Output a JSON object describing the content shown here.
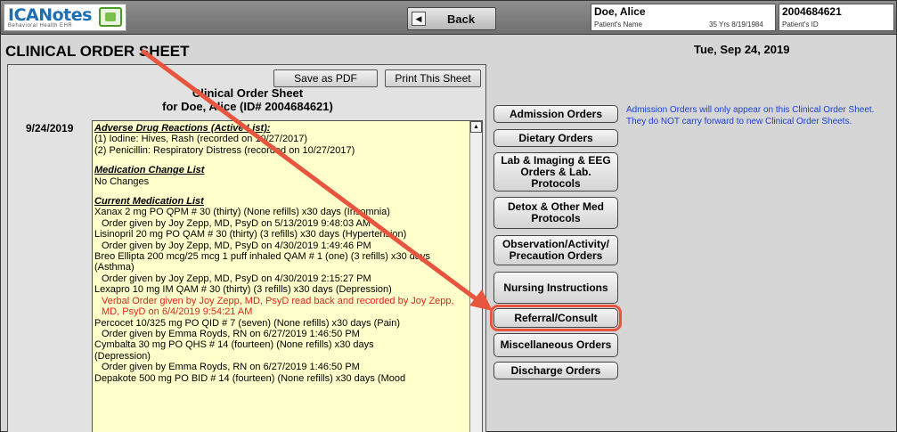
{
  "header": {
    "logo_text": "ICANotes",
    "logo_sub": "Behavioral Health EHR",
    "back_label": "Back",
    "patient_name": "Doe, Alice",
    "patient_name_caption": "Patient's Name",
    "patient_age_dob": "35 Yrs 8/19/1984",
    "patient_id": "2004684621",
    "patient_id_caption": "Patient's ID"
  },
  "page": {
    "title": "CLINICAL ORDER SHEET",
    "date": "Tue, Sep 24, 2019"
  },
  "sheet": {
    "save_pdf": "Save as PDF",
    "print": "Print This Sheet",
    "title_line1": "Clinical Order Sheet",
    "title_line2": "for Doe, Alice (ID# 2004684621)",
    "entry_date": "9/24/2019",
    "lines": {
      "adr_head": "Adverse Drug Reactions (Active List):",
      "adr1": "(1) Iodine: Hives, Rash (recorded on 10/27/2017)",
      "adr2": "(2) Penicillin: Respiratory Distress (recorded on 10/27/2017)",
      "mcl_head": "Medication Change List",
      "mcl1": "No Changes",
      "cml_head": "Current Medication List",
      "m1": "Xanax 2 mg PO QPM   # 30 (thirty)   (None refills) x30 days     (Insomnia)",
      "m1o": "Order given by Joy Zepp, MD, PsyD on 5/13/2019 9:48:03 AM",
      "m2": "Lisinopril 20 mg PO QAM   # 30 (thirty)   (3 refills) x30 days     (Hypertension)",
      "m2o": "Order given by Joy Zepp, MD, PsyD on 4/30/2019 1:49:46 PM",
      "m3": "Breo Ellipta 200 mcg/25 mcg 1 puff inhaled QAM   # 1 (one)   (3 refills) x30 days",
      "m3b": "(Asthma)",
      "m3o": "Order given by Joy Zepp, MD, PsyD on 4/30/2019 2:15:27 PM",
      "m4": "Lexapro 10 mg IM QAM   # 30 (thirty)   (3 refills) x30 days     (Depression)",
      "m4v": "Verbal Order given by Joy Zepp, MD, PsyD read back and recorded by Joy Zepp, MD, PsyD on 6/4/2019 9:54:21 AM",
      "m5": "Percocet 10/325 mg PO QID   # 7 (seven)   (None refills) x30 days     (Pain)",
      "m5o": "Order given by Emma Royds, RN on 6/27/2019 1:46:50 PM",
      "m6": "Cymbalta 30 mg PO QHS   # 14 (fourteen)   (None refills) x30 days",
      "m6b": "(Depression)",
      "m6o": "Order given by Emma Royds, RN on 6/27/2019 1:46:50 PM",
      "m7": "Depakote 500 mg PO BID   # 14 (fourteen)   (None refills) x30 days     (Mood"
    }
  },
  "orders": {
    "admission": "Admission Orders",
    "dietary": "Dietary Orders",
    "lab": "Lab & Imaging & EEG Orders & Lab. Protocols",
    "detox": "Detox & Other Med Protocols",
    "observation": "Observation/Activity/ Precaution Orders",
    "nursing": "Nursing Instructions",
    "referral": "Referral/Consult",
    "misc": "Miscellaneous Orders",
    "discharge": "Discharge Orders"
  },
  "notice": "Admission Orders will only appear on this Clinical Order Sheet. They do NOT carry forward to new Clinical Order Sheets.",
  "colors": {
    "highlight": "#e8553e",
    "notice_text": "#1a3fd8",
    "verbal_order": "#e2231a",
    "sheet_bg": "#ffffcc"
  }
}
